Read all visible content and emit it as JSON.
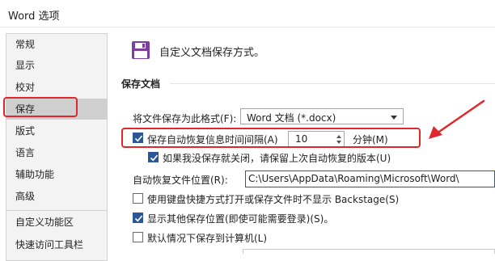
{
  "window": {
    "title": "Word 选项"
  },
  "sidebar": {
    "items": [
      {
        "label": "常规"
      },
      {
        "label": "显示"
      },
      {
        "label": "校对"
      },
      {
        "label": "保存"
      },
      {
        "label": "版式"
      },
      {
        "label": "语言"
      },
      {
        "label": "辅助功能"
      },
      {
        "label": "高级"
      },
      {
        "label": "自定义功能区"
      },
      {
        "label": "快速访问工具栏"
      }
    ],
    "selected": "保存"
  },
  "main": {
    "header": "自定义文档保存方式。",
    "section_title": "保存文档",
    "format_label": "将文件保存为此格式(F):",
    "format_value": "Word 文档 (*.docx)",
    "autorecover_label": "保存自动恢复信息时间间隔(A)",
    "autorecover_checked": true,
    "autorecover_minutes": "10",
    "minutes_label": "分钟(M)",
    "keep_last_label": "如果我没保存就关闭，请保留上次自动恢复的版本(U)",
    "keep_last_checked": true,
    "location_label": "自动恢复文件位置(R):",
    "location_value": "C:\\Users\\AppData\\Roaming\\Microsoft\\Word\\",
    "backstage_label": "使用键盘快捷方式打开或保存文件时不显示 Backstage(S)",
    "backstage_checked": false,
    "other_locations_label": "显示其他保存位置(即使可能需要登录)(S)。",
    "other_locations_checked": true,
    "default_computer_label": "默认情况下保存到计算机(L)",
    "default_computer_checked": false
  },
  "colors": {
    "highlight": "#e0282c",
    "checkbox": "#2b5797",
    "save_icon": "#7b3f9e"
  },
  "icons": {
    "header": "save-floppy-icon",
    "check": "check-icon"
  }
}
